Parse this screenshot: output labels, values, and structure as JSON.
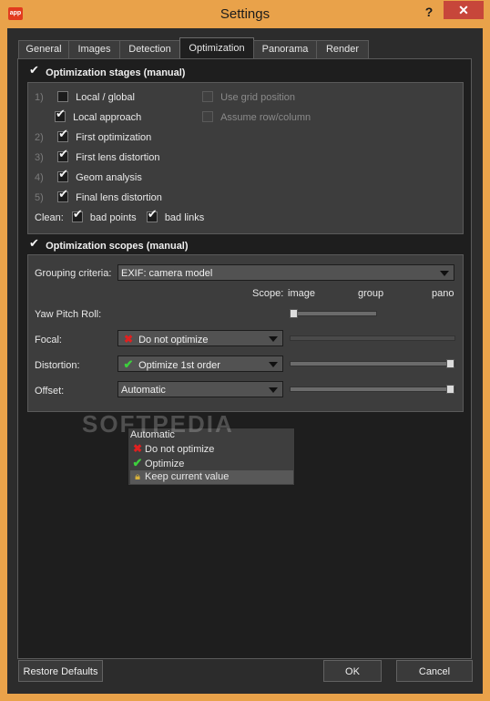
{
  "window": {
    "title": "Settings",
    "help": "?",
    "close": "✕",
    "app_icon": "app"
  },
  "tabs": [
    "General",
    "Images",
    "Detection",
    "Optimization",
    "Panorama",
    "Render"
  ],
  "stages": {
    "title": "Optimization stages (manual)",
    "items": [
      {
        "num": "1)",
        "label": "Local / global"
      },
      {
        "num": "",
        "label": "Local approach"
      },
      {
        "num": "2)",
        "label": "First optimization"
      },
      {
        "num": "3)",
        "label": "First lens distortion"
      },
      {
        "num": "4)",
        "label": "Geom analysis"
      },
      {
        "num": "5)",
        "label": "Final lens distortion"
      }
    ],
    "grid_position": "Use grid position",
    "row_column": "Assume row/column",
    "clean_label": "Clean:",
    "bad_points": "bad points",
    "bad_links": "bad links"
  },
  "scopes": {
    "title": "Optimization scopes (manual)",
    "grouping_label": "Grouping criteria:",
    "grouping_value": "EXIF: camera model",
    "scope_label": "Scope:",
    "scope_image": "image",
    "scope_group": "group",
    "scope_pano": "pano",
    "ypr_label": "Yaw Pitch Roll:",
    "focal_label": "Focal:",
    "focal_value": "Do not optimize",
    "distortion_label": "Distortion:",
    "distortion_value": "Optimize 1st order",
    "offset_label": "Offset:",
    "offset_value": "Automatic",
    "ypr_level": 0.0,
    "distortion_level": 1.0,
    "offset_level": 1.0
  },
  "dropdown": {
    "items": [
      "Automatic",
      "Do not optimize",
      "Optimize",
      "Keep current value"
    ]
  },
  "watermark": "SOFTPEDIA",
  "buttons": {
    "restore": "Restore Defaults",
    "ok": "OK",
    "cancel": "Cancel"
  }
}
